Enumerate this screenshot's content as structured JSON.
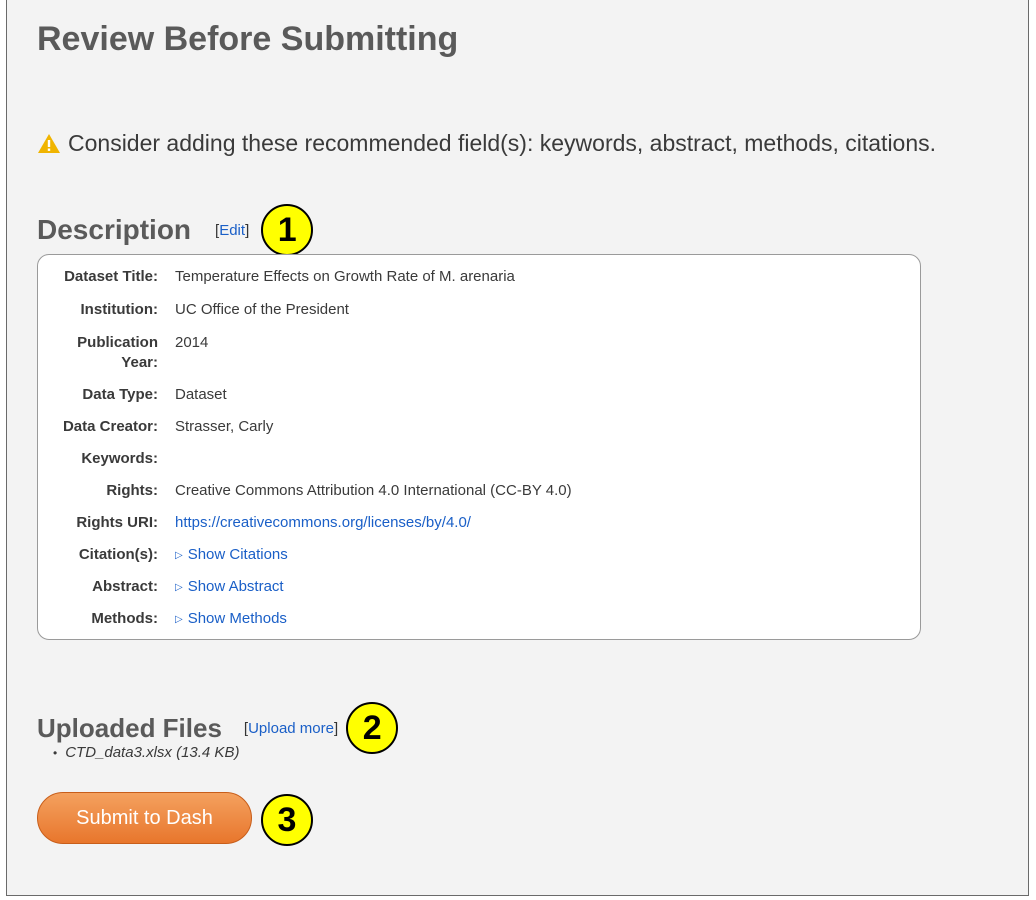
{
  "page": {
    "title": "Review Before Submitting"
  },
  "warning": {
    "icon": "warning-icon",
    "icon_color": "#f0b400",
    "text": "Consider adding these recommended field(s): keywords, abstract, methods, citations."
  },
  "description": {
    "heading": "Description",
    "edit_prefix": "[",
    "edit_label": "Edit",
    "edit_suffix": "]",
    "rows": [
      {
        "label": "Dataset Title:",
        "value": "Temperature Effects on Growth Rate of M. arenaria"
      },
      {
        "label": "Institution:",
        "value": "UC Office of the President"
      },
      {
        "label": "Publication",
        "label2": "Year:",
        "value": "2014"
      },
      {
        "label": "Data Type:",
        "value": "Dataset"
      },
      {
        "label": "Data Creator:",
        "value": "Strasser, Carly"
      },
      {
        "label": "Keywords:",
        "value": ""
      },
      {
        "label": "Rights:",
        "value": "Creative Commons Attribution 4.0 International (CC-BY 4.0)"
      },
      {
        "label": "Rights URI:",
        "value": "https://creativecommons.org/licenses/by/4.0/"
      },
      {
        "label": "Citation(s):",
        "value": "Show Citations"
      },
      {
        "label": "Abstract:",
        "value": "Show Abstract"
      },
      {
        "label": "Methods:",
        "value": "Show Methods"
      }
    ]
  },
  "files": {
    "heading": "Uploaded Files",
    "upload_prefix": "[",
    "upload_label": "Upload more",
    "upload_suffix": "]",
    "items": [
      "CTD_data3.xlsx (13.4 KB)"
    ]
  },
  "submit": {
    "label": "Submit to Dash",
    "color": "#e8762c"
  },
  "callouts": [
    "1",
    "2",
    "3"
  ],
  "colors": {
    "link": "#1a5fc7",
    "callout_fill": "#ffff00",
    "background": "#f3f3f3"
  }
}
